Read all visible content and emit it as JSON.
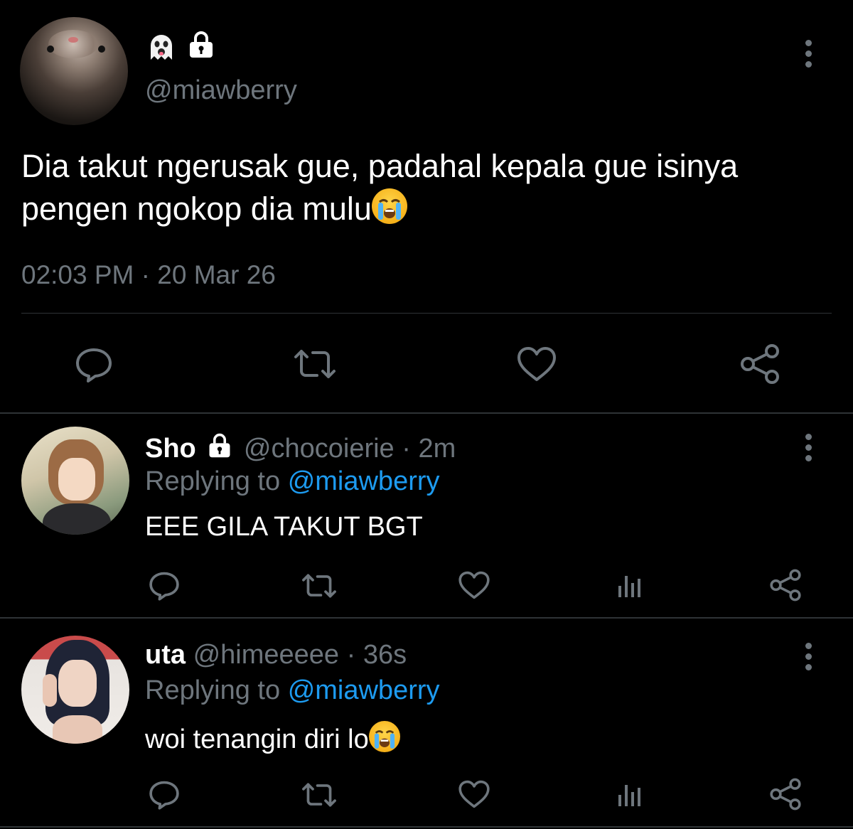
{
  "main_tweet": {
    "author_emoji_name": "ghost-emoji",
    "lock_icon": "lock-icon",
    "handle": "@miawberry",
    "text_line1": "Dia takut ngerusak gue, padahal kepala gue isinya",
    "text_line2": "pengen ngokop dia mulu",
    "text_emoji": "loudly-crying-face",
    "time": "02:03 PM",
    "separator": "·",
    "date": "20 Mar 26",
    "actions": [
      "reply-icon",
      "retweet-icon",
      "like-icon",
      "share-icon"
    ]
  },
  "replies": [
    {
      "name": "Sho",
      "handle": "@chocoierie",
      "dot": "·",
      "time": "2m",
      "replying_prefix": "Replying to",
      "replying_to": "@miawberry",
      "text": "EEE GILA TAKUT BGT",
      "actions": [
        "reply-icon",
        "retweet-icon",
        "like-icon",
        "analytics-icon",
        "share-icon"
      ]
    },
    {
      "name": "uta",
      "handle": "@himeeeee",
      "dot": "·",
      "time": "36s",
      "replying_prefix": "Replying to",
      "replying_to": "@miawberry",
      "text": "woi tenangin diri lo",
      "text_emoji": "loudly-crying-face",
      "actions": [
        "reply-icon",
        "retweet-icon",
        "like-icon",
        "analytics-icon",
        "share-icon"
      ]
    }
  ],
  "colors": {
    "background": "#000000",
    "text": "#e7e9ea",
    "muted": "#6e767d",
    "link": "#1d9bf0",
    "divider": "#2f3336"
  }
}
